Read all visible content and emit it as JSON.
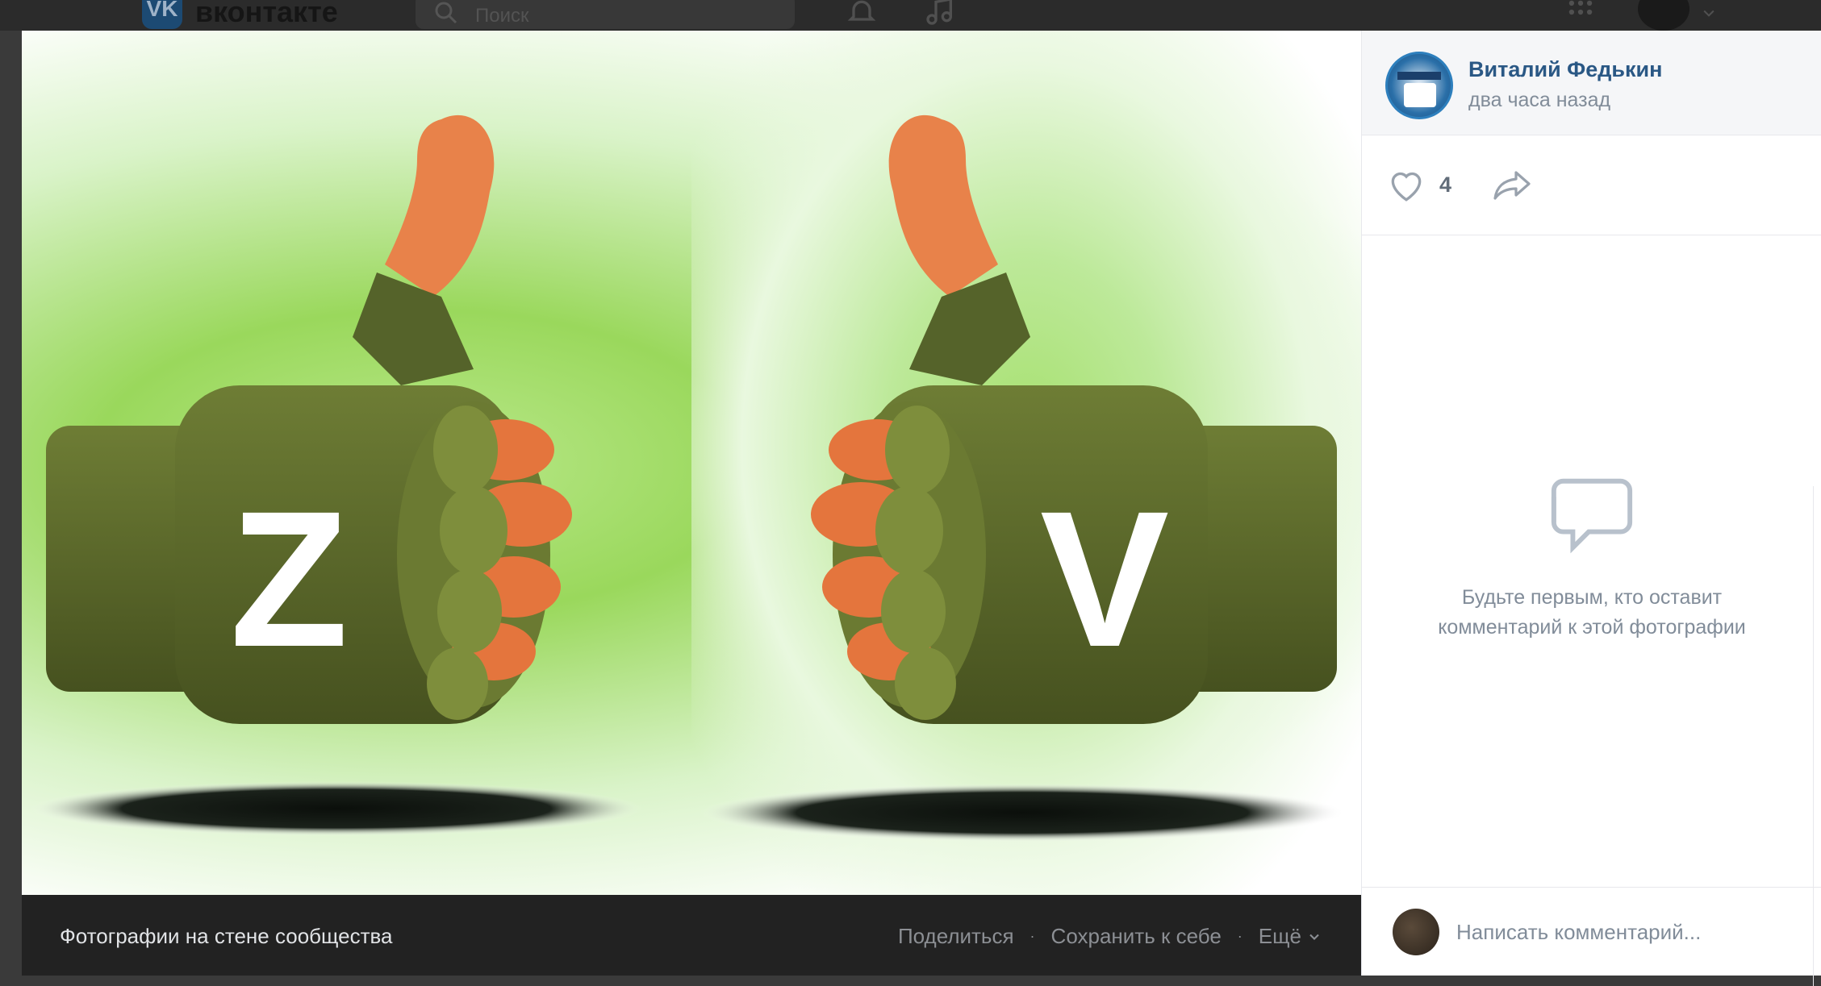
{
  "topbar": {
    "brand": "вконтакте",
    "search_placeholder": "Поиск"
  },
  "photo": {
    "left_letter": "Z",
    "right_letter": "V",
    "colors": {
      "glove": "#5b6a2a",
      "glow": "#9ad85c",
      "shadow": "#111511"
    }
  },
  "caption": {
    "title": "Фотографии на стене сообщества",
    "share_label": "Поделиться",
    "save_label": "Сохранить к себе",
    "more_label": "Ещё"
  },
  "author": {
    "name": "Виталий Федькин",
    "time": "два часа назад"
  },
  "actions": {
    "like_count": "4",
    "icons": [
      "heart-icon",
      "share-arrow-icon"
    ]
  },
  "comments": {
    "empty_line1": "Будьте первым, кто оставит",
    "empty_line2": "комментарий к этой фотографии",
    "input_placeholder": "Написать комментарий..."
  },
  "colors": {
    "accent": "#2a5885",
    "muted": "#818c99",
    "caption_bg": "#222222"
  }
}
